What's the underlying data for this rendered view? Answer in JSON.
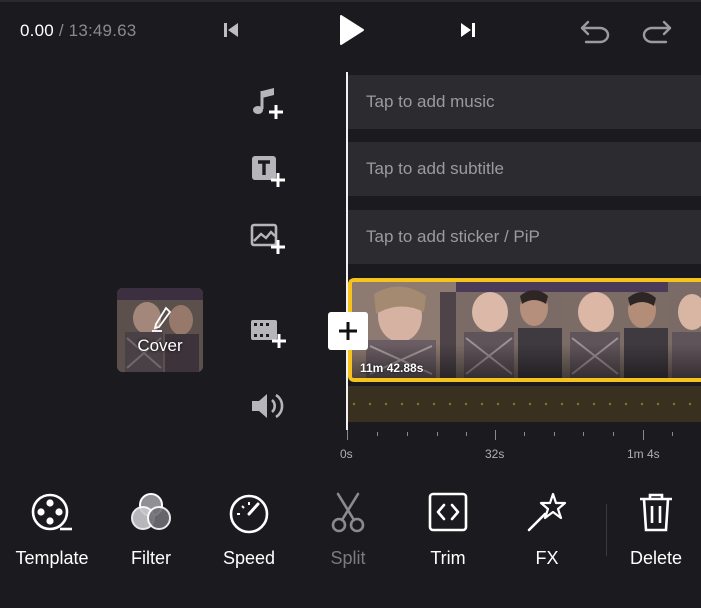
{
  "player": {
    "current_time": "0.00",
    "separator": " / ",
    "total_time": "13:49.63"
  },
  "tracks": {
    "music_placeholder": "Tap to add music",
    "subtitle_placeholder": "Tap to add subtitle",
    "sticker_placeholder": "Tap to add sticker / PiP"
  },
  "cover": {
    "label": "Cover"
  },
  "clip": {
    "duration": "11m 42.88s"
  },
  "ruler": {
    "labels": [
      "0s",
      "32s",
      "1m 4s"
    ]
  },
  "toolbar": {
    "items": [
      {
        "label": "Template",
        "icon": "film-reel-icon"
      },
      {
        "label": "Filter",
        "icon": "filter-circles-icon"
      },
      {
        "label": "Speed",
        "icon": "speedometer-icon"
      },
      {
        "label": "Split",
        "icon": "scissors-icon",
        "disabled": true
      },
      {
        "label": "Trim",
        "icon": "trim-brackets-icon"
      },
      {
        "label": "FX",
        "icon": "magic-wand-icon"
      },
      {
        "label": "Delete",
        "icon": "trash-icon"
      }
    ]
  },
  "colors": {
    "background": "#1b1b1f",
    "clip_border": "#f6c21c",
    "track_row": "#2b2b30"
  }
}
